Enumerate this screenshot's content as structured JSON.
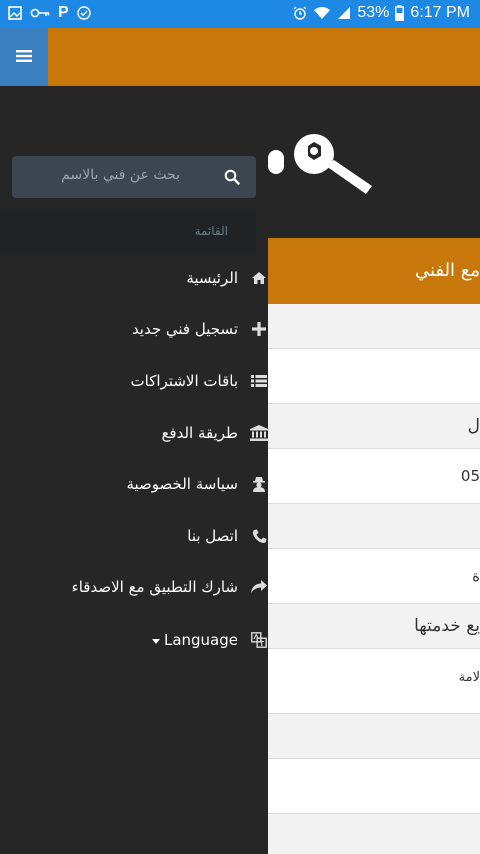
{
  "status_bar": {
    "battery": "53%",
    "time": "6:17 PM"
  },
  "search": {
    "placeholder": "بحث عن فني بالاسم"
  },
  "drawer": {
    "section_label": "القائمة",
    "items": [
      {
        "label": "الرئيسية",
        "icon": "home-icon"
      },
      {
        "label": "تسجيل فني جديد",
        "icon": "plus-icon"
      },
      {
        "label": "باقات الاشتراكات",
        "icon": "list-icon"
      },
      {
        "label": "طريقة الدفع",
        "icon": "bank-icon"
      },
      {
        "label": "سياسة الخصوصية",
        "icon": "user-secret-icon"
      },
      {
        "label": "اتصل بنا",
        "icon": "phone-icon"
      },
      {
        "label": "شارك التطبيق مع الاصدقاء",
        "icon": "share-icon"
      },
      {
        "label": "Language",
        "icon": "language-icon"
      }
    ]
  },
  "content": {
    "header": "مع الفني",
    "rows": [
      "",
      "",
      "ل",
      "05",
      "",
      "ة",
      "يع خدمتها",
      "لامة",
      "",
      "",
      ""
    ]
  },
  "colors": {
    "status_bar": "#1e88e5",
    "top_bar": "#c8780a",
    "menu_button": "#3a7fbf",
    "drawer": "#262626",
    "search": "#3b4650"
  }
}
